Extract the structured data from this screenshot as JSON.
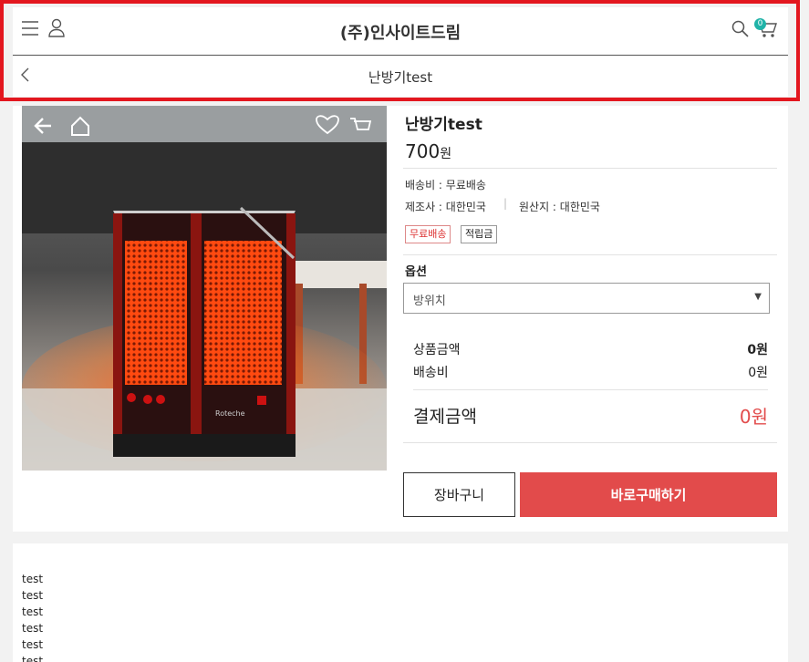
{
  "header": {
    "title": "(주)인사이트드림",
    "subtitle": "난방기test",
    "cart_count": "0",
    "icons": [
      "menu-icon",
      "user-icon",
      "search-icon",
      "cart-icon",
      "back-icon"
    ]
  },
  "product": {
    "name": "난방기test",
    "price": "700",
    "price_unit": "원",
    "shipping": "배송비 : 무료배송",
    "manufacturer": "제조사 : 대한민국",
    "origin": "원산지 : 대한민국",
    "badges": [
      "무료배송",
      "적립금"
    ],
    "option_label": "옵션",
    "option_selected": "방위치",
    "photo_icons": [
      "back-arrow-icon",
      "home-icon",
      "heart-icon",
      "cart-icon"
    ],
    "photo_brand": "Roteche"
  },
  "summary": {
    "subtotal_label": "상품금액",
    "subtotal_value": "0원",
    "shipping_label": "배송비",
    "shipping_value": "0원",
    "total_label": "결제금액",
    "total_value": "0원"
  },
  "buttons": {
    "cart": "장바구니",
    "buy": "바로구매하기"
  },
  "description": {
    "lines": [
      "test",
      "test",
      "test",
      "test",
      "test",
      "test"
    ]
  },
  "colors": {
    "accent": "#e24b4b",
    "frame": "#e3171f",
    "badge": "#20b3a8"
  }
}
